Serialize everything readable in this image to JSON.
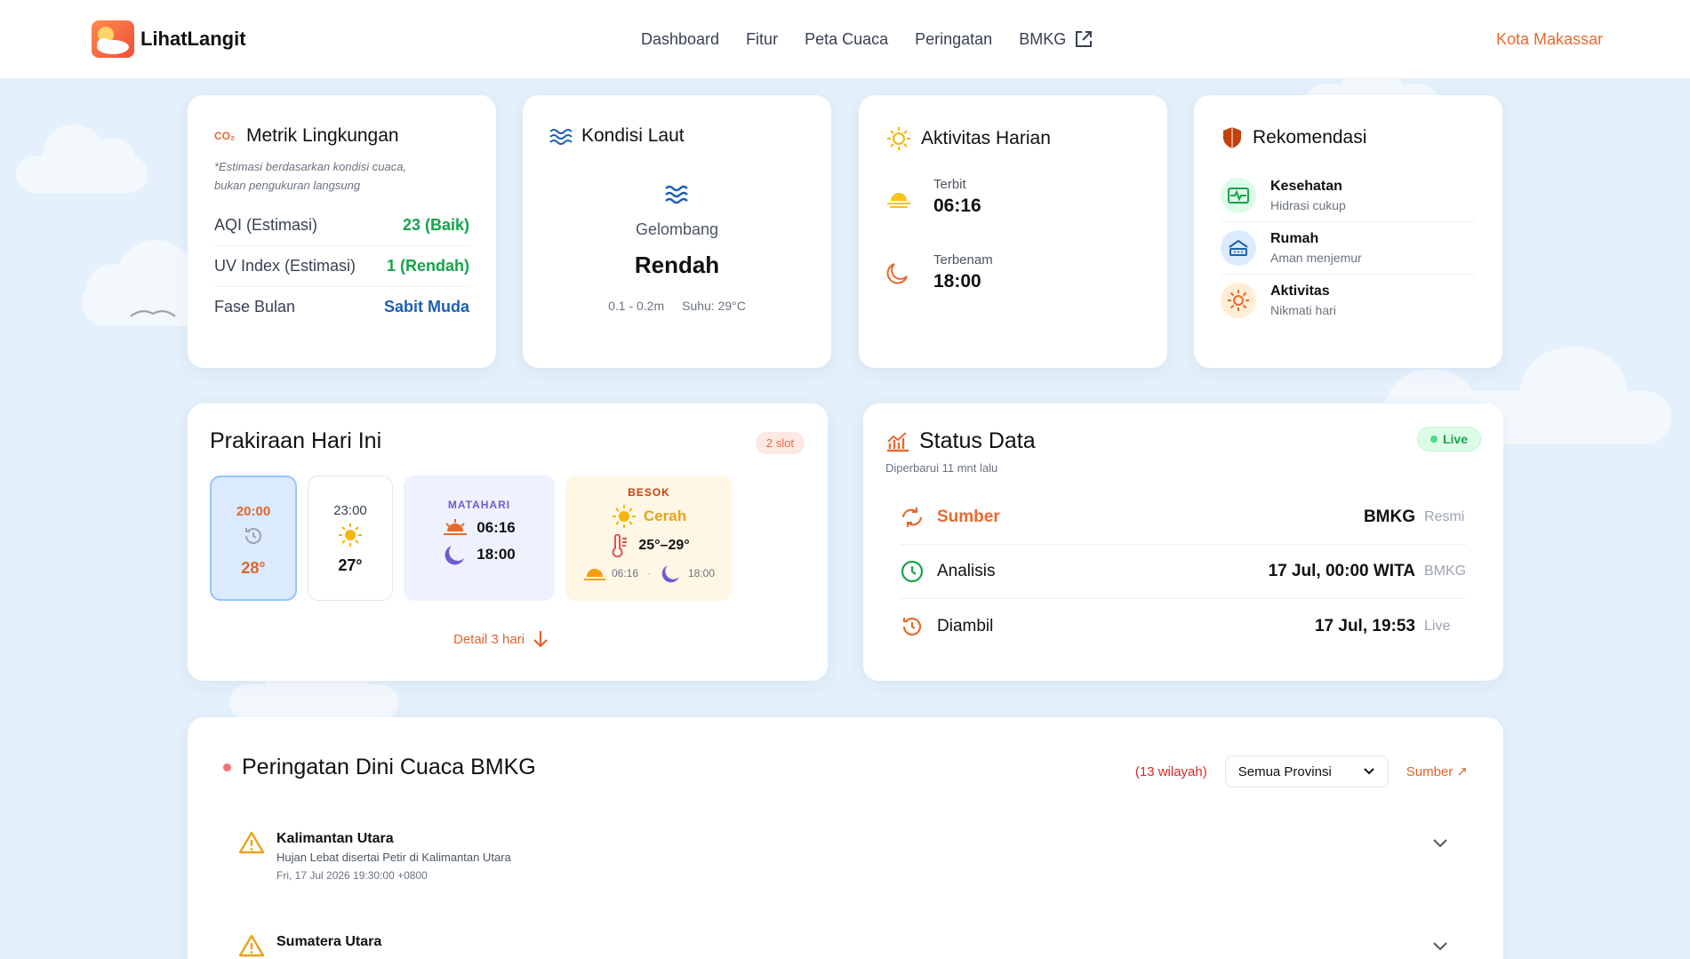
{
  "app": {
    "name": "LihatLangit"
  },
  "nav": {
    "items": [
      "Dashboard",
      "Fitur",
      "Peta Cuaca",
      "Peringatan"
    ],
    "bmkg": "BMKG",
    "city": "Kota Makassar"
  },
  "metrik": {
    "title": "Metrik Lingkungan",
    "note1": "*Estimasi berdasarkan kondisi cuaca,",
    "note2": "bukan pengukuran langsung",
    "rows": [
      {
        "label": "AQI (Estimasi)",
        "value": "23 (Baik)",
        "color": "#16a34a"
      },
      {
        "label": "UV Index (Estimasi)",
        "value": "1 (Rendah)",
        "color": "#16a34a"
      },
      {
        "label": "Fase Bulan",
        "value": "Sabit Muda",
        "color": "#1d5fb3"
      }
    ]
  },
  "laut": {
    "title": "Kondisi Laut",
    "label": "Gelombang",
    "value": "Rendah",
    "range": "0.1 - 0.2m",
    "suhu": "Suhu: 29°C"
  },
  "aktivitas": {
    "title": "Aktivitas Harian",
    "terbit_label": "Terbit",
    "terbit": "06:16",
    "terbenam_label": "Terbenam",
    "terbenam": "18:00"
  },
  "rekom": {
    "title": "Rekomendasi",
    "items": [
      {
        "title": "Kesehatan",
        "sub": "Hidrasi cukup"
      },
      {
        "title": "Rumah",
        "sub": "Aman menjemur"
      },
      {
        "title": "Aktivitas",
        "sub": "Nikmati hari"
      }
    ]
  },
  "prakiraan": {
    "title": "Prakiraan Hari Ini",
    "badge": "2 slot",
    "slot1": {
      "time": "20:00",
      "temp": "28°"
    },
    "slot2": {
      "time": "23:00",
      "temp": "27°"
    },
    "matahari": {
      "label": "MATAHARI",
      "rise": "06:16",
      "set": "18:00"
    },
    "besok": {
      "label": "BESOK",
      "cond": "Cerah",
      "temp": "25°–29°",
      "rise": "06:16",
      "sep": "·",
      "set": "18:00"
    },
    "detail": "Detail 3 hari"
  },
  "status": {
    "title": "Status Data",
    "updated": "Diperbarui 11 mnt lalu",
    "live": "Live",
    "rows": [
      {
        "label": "Sumber",
        "value": "BMKG",
        "small": "Resmi"
      },
      {
        "label": "Analisis",
        "value": "17 Jul, 00:00 WITA",
        "small": "BMKG"
      },
      {
        "label": "Diambil",
        "value": "17 Jul, 19:53",
        "small": "Live"
      }
    ]
  },
  "peringatan": {
    "title": "Peringatan Dini Cuaca BMKG",
    "count": "(13 wilayah)",
    "select": "Semua Provinsi",
    "source": "Sumber ↗",
    "items": [
      {
        "region": "Kalimantan Utara",
        "desc": "Hujan Lebat disertai Petir di Kalimantan Utara",
        "time": "Fri, 17 Jul 2026 19:30:00 +0800"
      },
      {
        "region": "Sumatera Utara",
        "desc": "",
        "time": ""
      }
    ]
  },
  "colors": {
    "accent": "#e8692d",
    "green": "#16a34a",
    "blue": "#1d5fb3",
    "bg": "#e4f0fb"
  }
}
